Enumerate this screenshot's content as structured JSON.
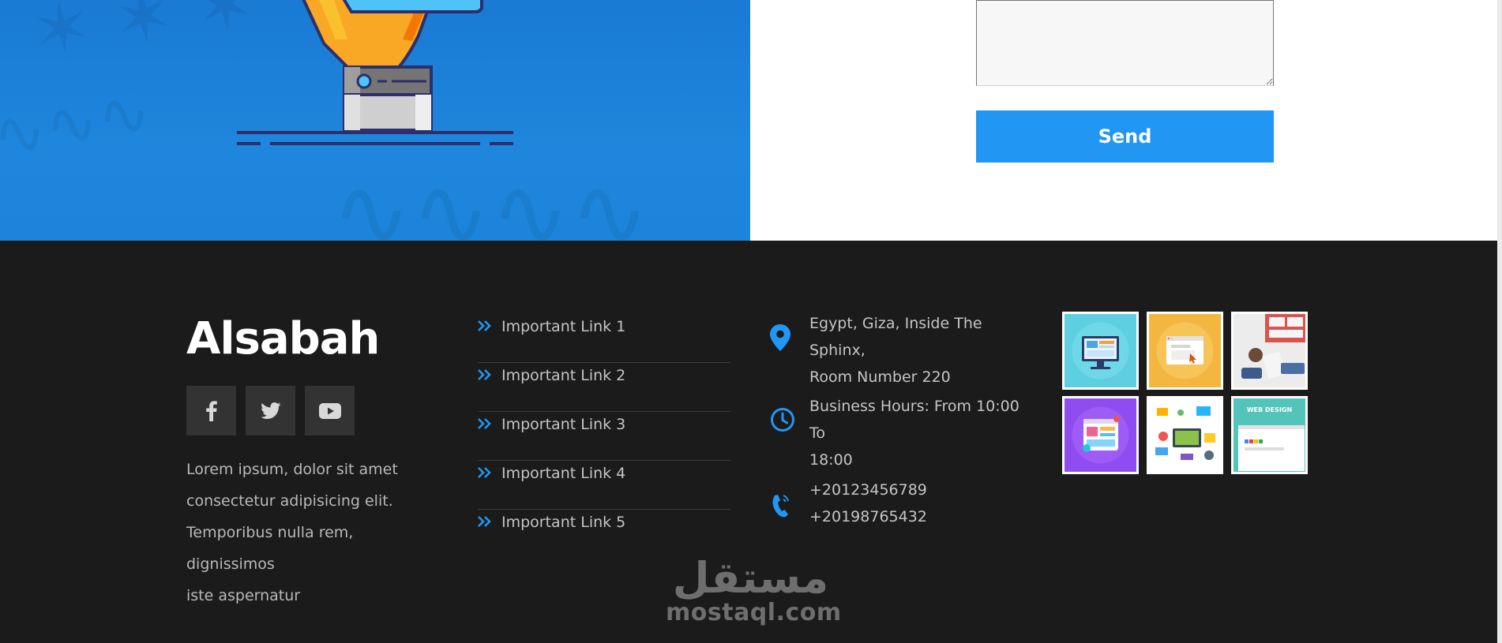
{
  "contact_form": {
    "message_value": "",
    "send_label": "Send"
  },
  "footer": {
    "brand": "Alsabah",
    "social": [
      {
        "icon": "facebook-icon"
      },
      {
        "icon": "twitter-icon"
      },
      {
        "icon": "youtube-icon"
      }
    ],
    "about_lines": [
      "Lorem ipsum, dolor sit amet",
      "consectetur adipisicing elit.",
      "Temporibus nulla rem, dignissimos",
      "iste aspernatur"
    ],
    "links": [
      {
        "label": "Important Link 1"
      },
      {
        "label": "Important Link 2"
      },
      {
        "label": "Important Link 3"
      },
      {
        "label": "Important Link 4"
      },
      {
        "label": "Important Link 5"
      }
    ],
    "contact": {
      "address_lines": [
        "Egypt, Giza, Inside The Sphinx,",
        "Room Number 220"
      ],
      "hours_lines": [
        "Business Hours: From 10:00 To",
        "18:00"
      ],
      "phones": [
        "+20123456789",
        "+20198765432"
      ]
    },
    "gallery": [
      {
        "icon": "monitor-design-image"
      },
      {
        "icon": "browser-window-image"
      },
      {
        "icon": "desk-photo-image"
      },
      {
        "icon": "mobile-app-image"
      },
      {
        "icon": "web-elements-image"
      },
      {
        "icon": "web-design-image"
      }
    ],
    "gallery_texts": {
      "web_design": "WEB DESIGN"
    }
  },
  "watermark": {
    "arabic": "مستقل",
    "latin": "mostaql.com"
  },
  "colors": {
    "accent": "#2196f3",
    "hero_blue": "#1e86dc",
    "footer_bg": "#1b1b1b"
  }
}
